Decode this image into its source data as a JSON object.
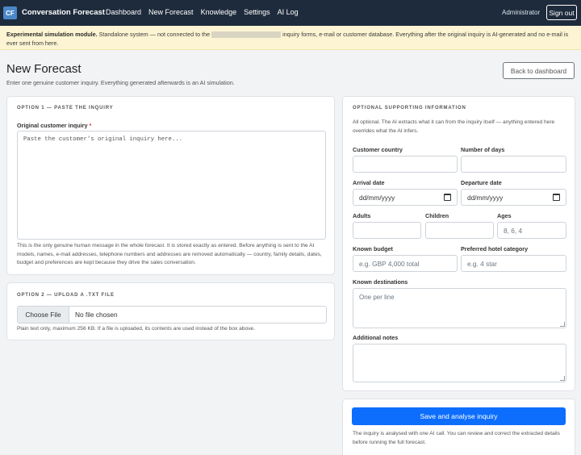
{
  "nav": {
    "logo": "CF",
    "brand": "Conversation Forecast",
    "links": [
      "Dashboard",
      "New Forecast",
      "Knowledge",
      "Settings",
      "AI Log"
    ],
    "user": "Administrator",
    "signout": "Sign out"
  },
  "banner": {
    "strong": "Experimental simulation module.",
    "text1": " Standalone system — not connected to the",
    "text2": " inquiry forms, e-mail or customer database. Everything after the original inquiry is AI-generated and no e-mail is ever sent from here."
  },
  "page": {
    "title": "New Forecast",
    "subtitle": "Enter one genuine customer inquiry. Everything generated afterwards is an AI simulation.",
    "back": "Back to dashboard"
  },
  "option1": {
    "title": "Option 1 — Paste the inquiry",
    "label": "Original customer inquiry",
    "required": "*",
    "placeholder": "Paste the customer's original inquiry here...",
    "help": "This is the only genuine human message in the whole forecast. It is stored exactly as entered. Before anything is sent to the AI models, names, e-mail addresses, telephone numbers and addresses are removed automatically — country, family details, dates, budget and preferences are kept because they drive the sales conversation."
  },
  "option2": {
    "title": "Option 2 — Upload a .txt file",
    "choose": "Choose File",
    "status": "No file chosen",
    "help": "Plain text only, maximum 256 KB. If a file is uploaded, its contents are used instead of the box above."
  },
  "optional": {
    "title": "Optional supporting information",
    "intro": "All optional. The AI extracts what it can from the inquiry itself — anything entered here overrides what the AI infers.",
    "country_label": "Customer country",
    "days_label": "Number of days",
    "arrival_label": "Arrival date",
    "departure_label": "Departure date",
    "date_placeholder": "dd/mm/yyyy",
    "adults_label": "Adults",
    "children_label": "Children",
    "ages_label": "Ages",
    "ages_placeholder": "8, 6, 4",
    "budget_label": "Known budget",
    "budget_placeholder": "e.g. GBP 4,000 total",
    "hotel_label": "Preferred hotel category",
    "hotel_placeholder": "e.g. 4 star",
    "destinations_label": "Known destinations",
    "destinations_placeholder": "One per line",
    "notes_label": "Additional notes"
  },
  "submit": {
    "label": "Save and analyse inquiry",
    "help": "The inquiry is analysed with one AI call. You can review and correct the extracted details before running the full forecast."
  }
}
